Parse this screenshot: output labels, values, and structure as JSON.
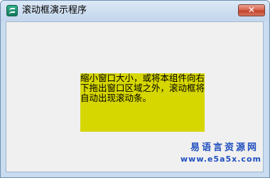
{
  "window": {
    "title": "滚动框演示程序",
    "close_symbol": "✕"
  },
  "panel": {
    "text": "缩小窗口大小，或将本组件向右下拖出窗口区域之外，滚动框将自动出现滚动条。"
  },
  "watermark": {
    "line1": "易语言资源网",
    "line2": "www.e5a5x.com"
  },
  "colors": {
    "panel_background": "#d6d600",
    "client_background": "#f0f0f0",
    "close_button": "#c2432c",
    "watermark": "#1f4fbf"
  }
}
